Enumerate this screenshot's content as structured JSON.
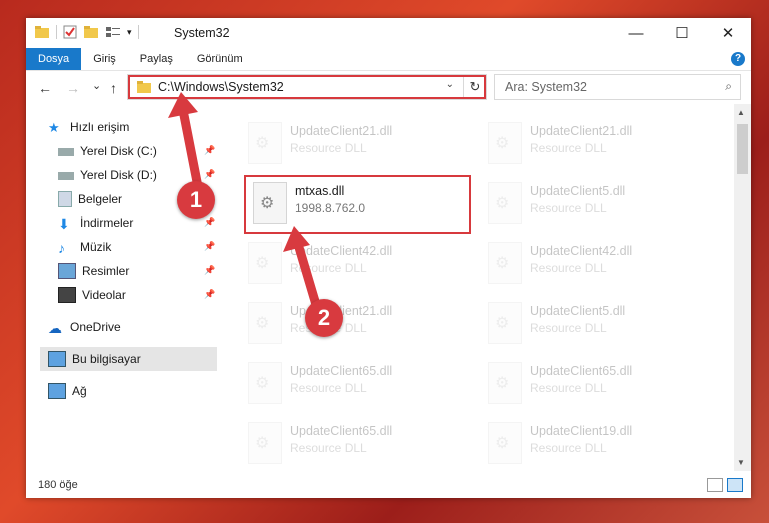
{
  "window": {
    "title": "System32",
    "minimize_glyph": "—",
    "maximize_glyph": "☐",
    "close_glyph": "✕"
  },
  "ribbon": {
    "tabs": [
      "Dosya",
      "Giriş",
      "Paylaş",
      "Görünüm"
    ],
    "help_glyph": "?"
  },
  "navigation": {
    "back_glyph": "←",
    "forward_glyph": "→",
    "recent_glyph": "⌄",
    "up_glyph": "↑",
    "address": "C:\\Windows\\System32",
    "dropdown_glyph": "⌄",
    "refresh_glyph": "↻",
    "search_placeholder": "Ara: System32",
    "search_glyph": "⌕"
  },
  "sidebar": {
    "items": [
      {
        "label": "Hızlı erişim",
        "icon": "star-icon"
      },
      {
        "label": "Yerel Disk (C:)",
        "icon": "drive-icon"
      },
      {
        "label": "Yerel Disk (D:)",
        "icon": "drive-icon"
      },
      {
        "label": "Belgeler",
        "icon": "documents-icon"
      },
      {
        "label": "İndirmeler",
        "icon": "download-icon"
      },
      {
        "label": "Müzik",
        "icon": "music-icon"
      },
      {
        "label": "Resimler",
        "icon": "pictures-icon"
      },
      {
        "label": "Videolar",
        "icon": "videos-icon"
      },
      {
        "label": "OneDrive",
        "icon": "cloud-icon"
      },
      {
        "label": "Bu bilgisayar",
        "icon": "computer-icon"
      },
      {
        "label": "Ağ",
        "icon": "network-icon"
      }
    ]
  },
  "files": {
    "highlighted": {
      "name": "mtxas.dll",
      "sub": "1998.8.762.0"
    },
    "items": [
      {
        "name": "UpdateClient21.dll",
        "sub": "Resource DLL"
      },
      {
        "name": "UpdateClient21.dll",
        "sub": "Resource DLL"
      },
      {
        "name": "UpdateClient5.dll",
        "sub": "Resource DLL"
      },
      {
        "name": "UpdateClient42.dll",
        "sub": "Resource DLL"
      },
      {
        "name": "UpdateClient42.dll",
        "sub": "Resource DLL"
      },
      {
        "name": "UpdateClient21.dll",
        "sub": "Resource DLL"
      },
      {
        "name": "UpdateClient5.dll",
        "sub": "Resource DLL"
      },
      {
        "name": "UpdateClient65.dll",
        "sub": "Resource DLL"
      },
      {
        "name": "UpdateClient65.dll",
        "sub": "Resource DLL"
      },
      {
        "name": "UpdateClient65.dll",
        "sub": "Resource DLL"
      },
      {
        "name": "UpdateClient19.dll",
        "sub": "Resource DLL"
      }
    ]
  },
  "status": {
    "item_count": "180 öğe"
  },
  "callouts": [
    "1",
    "2"
  ],
  "colors": {
    "accent": "#1979ca",
    "callout": "#d83a3f",
    "highlight_border": "#d7393d"
  }
}
